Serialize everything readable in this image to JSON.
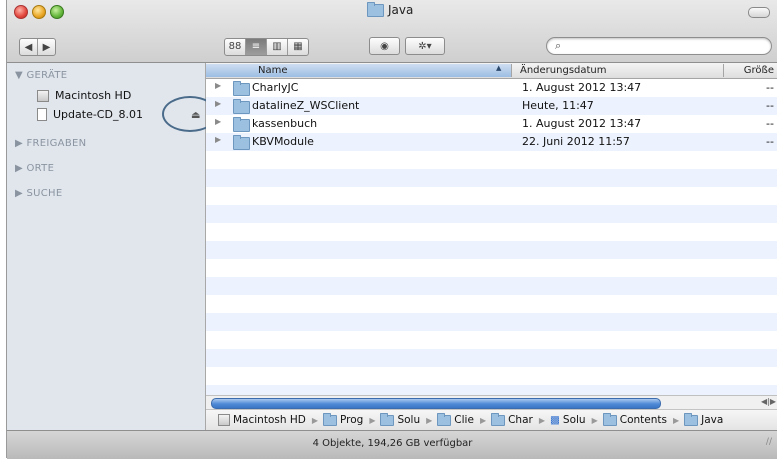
{
  "window": {
    "title": "Java"
  },
  "toolbar": {
    "back": "◀",
    "forward": "▶",
    "view_icon": "88",
    "view_list": "≡",
    "view_column": "▥",
    "view_coverflow": "▦",
    "quicklook": "◉",
    "action": "✲▾",
    "search_value": "",
    "search_placeholder": ""
  },
  "sidebar": {
    "devices_header": "▼ GERÄTE",
    "devices": [
      {
        "label": "Macintosh HD",
        "icon": "drive-icon"
      },
      {
        "label": "Update-CD_8.01",
        "icon": "disk-icon"
      }
    ],
    "eject_symbol": "⏏",
    "shared_header": "▶ FREIGABEN",
    "places_header": "▶ ORTE",
    "search_header": "▶ SUCHE"
  },
  "columns": {
    "name": "Name",
    "date": "Änderungsdatum",
    "size": "Größe"
  },
  "files": [
    {
      "name": "CharlyJC",
      "date": "1. August 2012 13:47",
      "size": "--"
    },
    {
      "name": "datalineZ_WSClient",
      "date": "Heute, 11:47",
      "size": "--"
    },
    {
      "name": "kassenbuch",
      "date": "1. August 2012 13:47",
      "size": "--"
    },
    {
      "name": "KBVModule",
      "date": "22. Juni 2012 11:57",
      "size": "--"
    }
  ],
  "pathbar": [
    "Macintosh HD",
    "Prog",
    "Solu",
    "Clie",
    "Char",
    "Solu",
    "Contents",
    "Java"
  ],
  "status": "4 Objekte, 194,26 GB verfügbar",
  "colors": {
    "selection_header": "#9cbde2",
    "alt_row": "#edf3fe",
    "sidebar_bg": "#e1e6ed"
  }
}
